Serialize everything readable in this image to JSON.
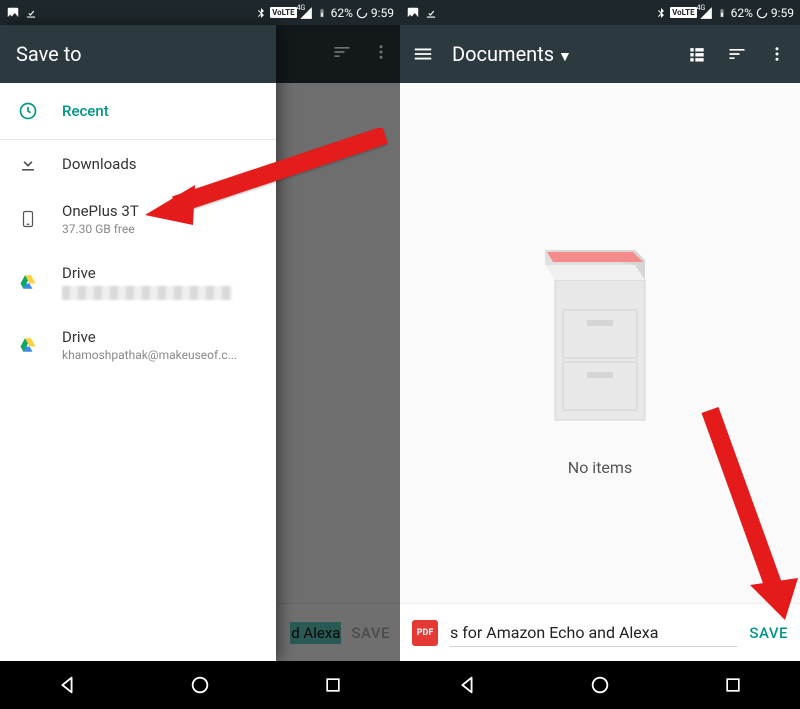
{
  "status": {
    "network_label": "VoLTE",
    "signal_gen": "4G",
    "battery": "62%",
    "time": "9:59"
  },
  "left": {
    "drawer_title": "Save to",
    "recent_label": "Recent",
    "downloads_label": "Downloads",
    "device": {
      "name": "OnePlus 3T",
      "free": "37.30 GB free"
    },
    "drive1": {
      "label": "Drive"
    },
    "drive2": {
      "label": "Drive",
      "account": "khamoshpathak@makeuseof.c..."
    },
    "hidden_filename_tail": "d Alexa",
    "hidden_save": "SAVE"
  },
  "right": {
    "title": "Documents",
    "empty_text": "No items",
    "pdf_badge": "PDF",
    "filename": "s for Amazon Echo and Alexa",
    "save_label": "SAVE"
  }
}
